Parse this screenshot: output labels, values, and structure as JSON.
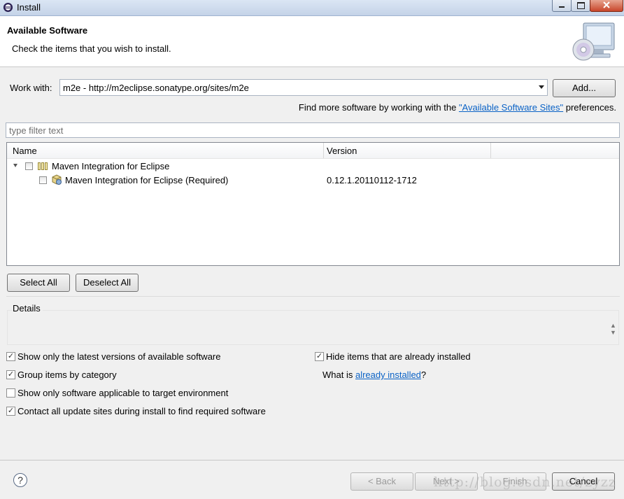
{
  "window": {
    "title": "Install"
  },
  "header": {
    "heading": "Available Software",
    "subheading": "Check the items that you wish to install."
  },
  "work_with": {
    "label": "Work with:",
    "value": "m2e - http://m2eclipse.sonatype.org/sites/m2e",
    "add_label": "Add..."
  },
  "find_more": {
    "prefix": "Find more software by working with the ",
    "link": "\"Available Software Sites\"",
    "suffix": " preferences."
  },
  "filter": {
    "placeholder": "type filter text"
  },
  "table": {
    "columns": [
      "Name",
      "Version"
    ],
    "rows": [
      {
        "name": "Maven Integration for Eclipse",
        "version": ""
      },
      {
        "name": "Maven Integration for Eclipse (Required)",
        "version": "0.12.1.20110112-1712"
      }
    ]
  },
  "selection": {
    "select_all": "Select All",
    "deselect_all": "Deselect All"
  },
  "details": {
    "label": "Details"
  },
  "options": {
    "latest_versions": {
      "label": "Show only the latest versions of available software",
      "checked": true
    },
    "group_by_category": {
      "label": "Group items by category",
      "checked": true
    },
    "target_env": {
      "label": "Show only software applicable to target environment",
      "checked": false
    },
    "contact_sites": {
      "label": "Contact all update sites during install to find required software",
      "checked": true
    },
    "hide_installed": {
      "label": "Hide items that are already installed",
      "checked": true
    },
    "what_is": {
      "prefix": "What is ",
      "link": "already installed",
      "suffix": "?"
    }
  },
  "footer": {
    "help": "?",
    "back": "< Back",
    "next": "Next >",
    "finish": "Finish",
    "cancel": "Cancel",
    "watermark": "http://blog.csdn.net/zyzz"
  },
  "colors": {
    "link": "#0a62c6",
    "close_button": "#c8452a"
  }
}
